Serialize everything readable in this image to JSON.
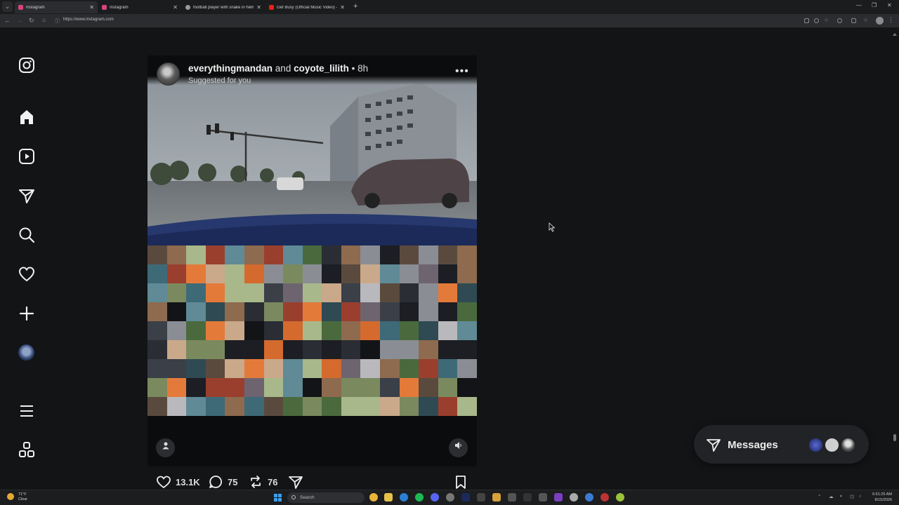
{
  "browser": {
    "tabs": [
      {
        "title": "Instagram",
        "active": true,
        "favicon_color": "#d8437b"
      },
      {
        "title": "Instagram",
        "active": false,
        "favicon_color": "#d8437b"
      },
      {
        "title": "football player with snake in helm...",
        "active": false,
        "favicon_color": "#9a9a9a"
      },
      {
        "title": "Get Busy (Official Music Video) - Yo...",
        "active": false,
        "favicon_color": "#e62117"
      }
    ],
    "url": "https://www.instagram.com",
    "new_tab": "+",
    "close_glyph": "✕"
  },
  "sidebar": {
    "items": [
      {
        "name": "instagram-logo-icon"
      },
      {
        "name": "home-icon"
      },
      {
        "name": "reels-icon"
      },
      {
        "name": "direct-messages-icon"
      },
      {
        "name": "search-icon"
      },
      {
        "name": "notifications-heart-icon"
      },
      {
        "name": "create-plus-icon"
      },
      {
        "name": "profile-avatar"
      },
      {
        "name": "more-menu-icon"
      },
      {
        "name": "also-from-meta-icon"
      }
    ]
  },
  "post": {
    "author": "everythingmandan",
    "conjunction": "and",
    "collaborator": "coyote_lilith",
    "separator": "•",
    "time": "8h",
    "subtitle": "Suggested for you",
    "more_glyph": "•••",
    "likes": "13.1K",
    "comments": "75",
    "reposts": "76"
  },
  "messages": {
    "label": "Messages",
    "avatar_colors": [
      "#2e3c8c",
      "#cfcfcf",
      "#6f6f6f"
    ]
  },
  "taskbar": {
    "weather_temp": "71°F",
    "weather_desc": "Clear",
    "search_placeholder": "Search",
    "time": "6:51:25 AM",
    "date": "8/15/2026"
  },
  "colors": {
    "background": "#121416",
    "accent_blue": "#3aa0f0"
  }
}
